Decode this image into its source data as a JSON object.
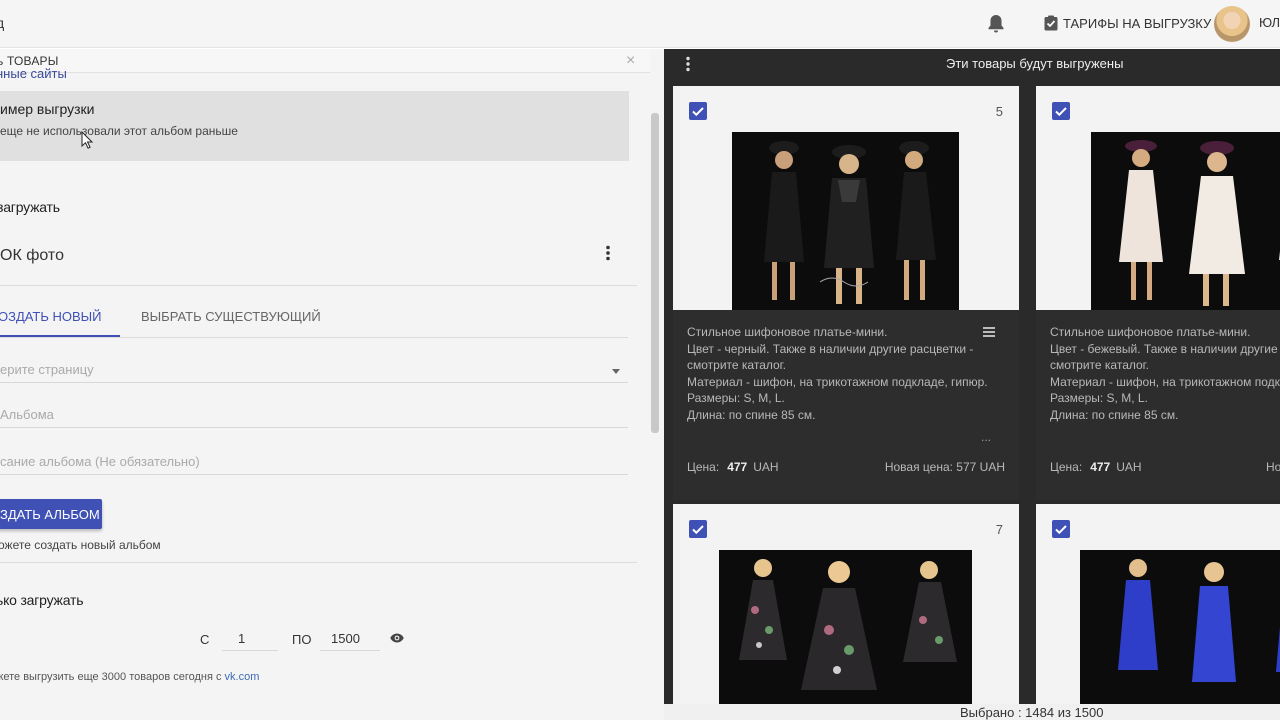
{
  "topbar": {
    "left_text": "д",
    "tariffs_label": "ТАРИФЫ НА ВЫГРУЗКУ",
    "user_name": "ЮЛ"
  },
  "left": {
    "header_title": "ь ТОВАРЫ",
    "close_symbol": "×",
    "sites_link": "нные сайты",
    "example_title": "имер выгрузки",
    "example_subtitle": "еще не использовали этот альбом раньше",
    "upload_label": "загружать",
    "album_source": "ОК фото",
    "tabs": [
      {
        "label": "ОЗДАТЬ НОВЫЙ",
        "active": true
      },
      {
        "label": "ВЫБРАТЬ СУЩЕСТВУЮЩИЙ",
        "active": false
      }
    ],
    "page_select_placeholder": "ерите страницу",
    "album_name_placeholder": " Альбома",
    "album_desc_placeholder": "сание альбома (Не обязательно)",
    "create_button": "ЗДАТЬ АЛЬБОМ",
    "create_hint": "ожете создать новый альбом",
    "only_upload_label": "ько загружать",
    "range_from_label": "С",
    "range_from_value": "1",
    "range_to_label": "ПО",
    "range_to_value": "1500",
    "limit_text": "жете выгрузить еще 3000 товаров сегодня с ",
    "limit_link": "vk.com"
  },
  "right": {
    "title": "Эти товары будут выгружены",
    "status": "Выбрано : 1484 из 1500",
    "cards": [
      {
        "number": "5",
        "desc_lines": [
          "Стильное шифоновое платье-мини.",
          "Цвет - черный. Также в наличии другие расцветки -",
          "смотрите каталог.",
          "Материал - шифон, на трикотажном подкладе, гипюр.",
          "Размеры: S, M, L.",
          "Длина: по спине 85 см."
        ],
        "more": "...",
        "price_label": "Цена:",
        "price": "477",
        "currency": "UAH",
        "new_price": "Новая цена: 577 UAH"
      },
      {
        "number": "",
        "desc_lines": [
          "Стильное шифоновое платье-мини.",
          "Цвет - бежевый. Также в наличии другие",
          "смотрите каталог.",
          "Материал - шифон, на трикотажном подкл",
          "Размеры: S, M, L.",
          "Длина: по спине 85 см."
        ],
        "more": "",
        "price_label": "Цена:",
        "price": "477",
        "currency": "UAH",
        "new_price": "Нова"
      },
      {
        "number": "7"
      },
      {
        "number": ""
      }
    ]
  },
  "colors": {
    "accent": "#3f51b5",
    "dark_panel": "#2a2a2a",
    "card_body": "#2d2d2d"
  }
}
